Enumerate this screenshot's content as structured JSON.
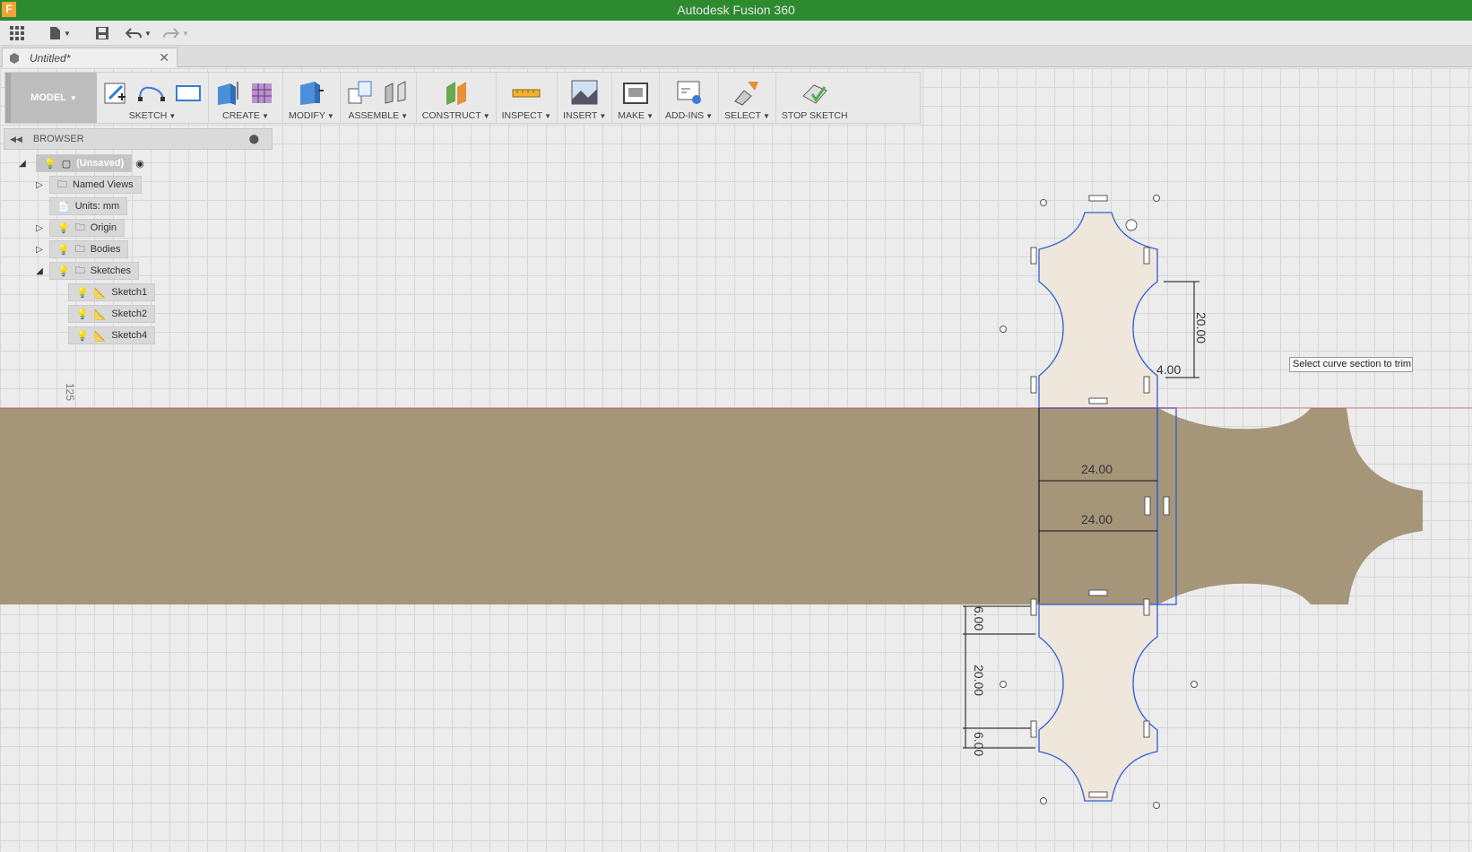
{
  "window": {
    "title": "Autodesk Fusion 360",
    "logo_letter": "F"
  },
  "quick_access": {
    "icons": [
      "grid-icon",
      "file-icon",
      "save-icon",
      "undo-icon",
      "redo-icon"
    ]
  },
  "document_tab": {
    "name": "Untitled*"
  },
  "toolbar": {
    "workspace": "MODEL",
    "groups": [
      {
        "label": "SKETCH"
      },
      {
        "label": "CREATE"
      },
      {
        "label": "MODIFY"
      },
      {
        "label": "ASSEMBLE"
      },
      {
        "label": "CONSTRUCT"
      },
      {
        "label": "INSPECT"
      },
      {
        "label": "INSERT"
      },
      {
        "label": "MAKE"
      },
      {
        "label": "ADD-INS"
      },
      {
        "label": "SELECT"
      },
      {
        "label": "STOP SKETCH"
      }
    ]
  },
  "browser": {
    "title": "BROWSER",
    "root": "(Unsaved)",
    "named_views": "Named Views",
    "units": "Units: mm",
    "origin": "Origin",
    "bodies": "Bodies",
    "sketches": "Sketches",
    "sketch_items": [
      "Sketch1",
      "Sketch2",
      "Sketch4"
    ]
  },
  "canvas": {
    "ruler_label": "125",
    "tooltip": "Select curve section to trim",
    "dimensions": {
      "top_height": "20.00",
      "small_offset": "4.00",
      "width_upper": "24.00",
      "width_lower": "24.00",
      "bottom_gap_top": "6.00",
      "bottom_height": "20.00",
      "bottom_gap_bottom": "6.00"
    }
  },
  "colors": {
    "title_bar": "#2d8a2f",
    "body_fill": "#a59679",
    "profile_fill": "#efe6dc",
    "sketch_line": "#2d5fd3",
    "axis": "#d83b3b"
  }
}
